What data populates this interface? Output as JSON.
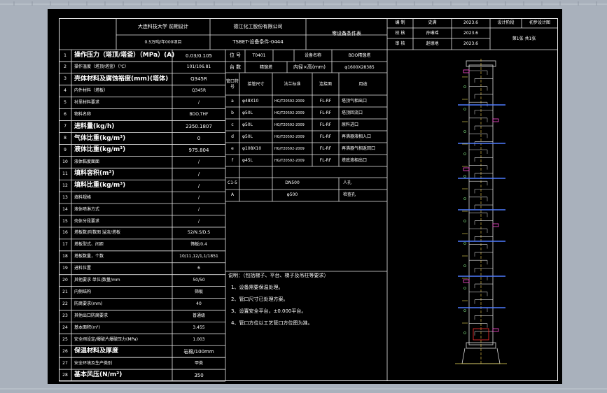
{
  "header": {
    "university": "大连科技大学 前期设计",
    "company": "德江化工股份有限公司",
    "doc_title": "零设备条件表",
    "scale": "0.5万吨/年000项目",
    "project_code": "TSBET-设备条件-0444",
    "sign_rows": [
      {
        "role": "编 制",
        "name": "史满",
        "date": "2023.6"
      },
      {
        "role": "校 核",
        "name": "孙琳瑶",
        "date": "2023.6"
      },
      {
        "role": "审 核",
        "name": "赵德地",
        "date": "2023.6"
      }
    ],
    "stage_label": "设计阶段",
    "stage_value": "初步设计图",
    "page_label": "第1张 共1张"
  },
  "spec_rows": [
    {
      "no": "1",
      "label": "操作压力（塔顶/塔釜）（MPa）(A)",
      "value": "0.03/0.105",
      "big": true
    },
    {
      "no": "2",
      "label": "操作温度（塔顶/塔釜）（℃）",
      "value": "101/106.81",
      "big": false
    },
    {
      "no": "3",
      "label": "壳体材料及腐蚀裕度(mm)(塔体)",
      "value": "Q345R",
      "big": true
    },
    {
      "no": "4",
      "label": "内件材料（塔板）",
      "value": "Q345R",
      "big": false
    },
    {
      "no": "5",
      "label": "衬里材料要求",
      "value": "/",
      "big": false
    },
    {
      "no": "6",
      "label": "物料名称",
      "value": "BDO,THF",
      "big": false
    },
    {
      "no": "7",
      "label": "进料量(kg/h)",
      "value": "2350.1807",
      "big": true
    },
    {
      "no": "8",
      "label": "气体比重(kg/m³)",
      "value": "0",
      "big": true
    },
    {
      "no": "9",
      "label": "液体比重(kg/m³)",
      "value": "975.804",
      "big": true
    },
    {
      "no": "10",
      "label": "液体黏度面面",
      "value": "/",
      "big": false
    },
    {
      "no": "11",
      "label": "填料容积(m³)",
      "value": "/",
      "big": true
    },
    {
      "no": "12",
      "label": "填料比重(kg/m³)",
      "value": "/",
      "big": true
    },
    {
      "no": "13",
      "label": "填料规格",
      "value": "/",
      "big": false
    },
    {
      "no": "14",
      "label": "液体喷淋方式",
      "value": "/",
      "big": false
    },
    {
      "no": "15",
      "label": "壳体分段要求",
      "value": "/",
      "big": false
    },
    {
      "no": "16",
      "label": "塔板数/阶数图 溢流/塔板",
      "value": "52/N.S/D.S",
      "big": false
    },
    {
      "no": "17",
      "label": "塔板型式、间距",
      "value": "筛板/0.4",
      "big": false
    },
    {
      "no": "18",
      "label": "塔板数量，个数",
      "value": "10/11,12/1,1/1851",
      "big": false
    },
    {
      "no": "19",
      "label": "进料位置",
      "value": "6",
      "big": false
    },
    {
      "no": "20",
      "label": "其他要求 单位/数量/mm",
      "value": "50/50",
      "big": false
    },
    {
      "no": "21",
      "label": "内侧结构",
      "value": "筛板",
      "big": false
    },
    {
      "no": "22",
      "label": "防腐要求(mm)",
      "value": "40",
      "big": false
    },
    {
      "no": "23",
      "label": "其他出口防腐要求",
      "value": "普通级",
      "big": false
    },
    {
      "no": "24",
      "label": "基本面积(m²)",
      "value": "3.455",
      "big": false
    },
    {
      "no": "25",
      "label": "安全阀设定/爆破片爆破压力(MPa)",
      "value": "1.003",
      "big": false
    },
    {
      "no": "26",
      "label": "保温材料及厚度",
      "value": "岩棉/100mm",
      "big": true
    },
    {
      "no": "27",
      "label": "安全环境及生产类别",
      "value": "甲类",
      "big": false
    },
    {
      "no": "28",
      "label": "基本风压(N/m²)",
      "value": "350",
      "big": true
    }
  ],
  "info": {
    "position_label": "位 号",
    "position_value": "T0401",
    "name_label": "设备名称",
    "name_value": "BDO精馏塔",
    "count_label": "台 数",
    "count_value": "精馏塔",
    "diameter_label": "内径×高(mm)",
    "diameter_value": "φ1600X28385"
  },
  "nozzle_header": {
    "mark": "管口符号",
    "size": "接管尺寸",
    "std": "法兰标准",
    "face": "连接面",
    "use": "用途"
  },
  "nozzles": [
    {
      "mark": "a",
      "size": "φ48X10",
      "std": "HG/T20592-2009",
      "face": "FL-RF",
      "use": "塔顶气相出口"
    },
    {
      "mark": "b",
      "size": "φ50L",
      "std": "HG/T20592-2009",
      "face": "FL-RF",
      "use": "塔顶回流口"
    },
    {
      "mark": "c",
      "size": "φ50L",
      "std": "HG/T20592-2009",
      "face": "FL-RF",
      "use": "原料进口"
    },
    {
      "mark": "d",
      "size": "φ50L",
      "std": "HG/T20592-2009",
      "face": "FL-RF",
      "use": "再沸器液相入口"
    },
    {
      "mark": "e",
      "size": "φ108X10",
      "std": "HG/T20592-2009",
      "face": "FL-RF",
      "use": "再沸器气相返回口"
    },
    {
      "mark": "f",
      "size": "φ45L",
      "std": "HG/T20592-2009",
      "face": "FL-RF",
      "use": "塔底液相出口"
    }
  ],
  "manhole": [
    {
      "mark": "C1-5",
      "size": "DN500",
      "use": "人孔"
    },
    {
      "mark": "A",
      "size": "φ500",
      "use": "检查孔"
    }
  ],
  "notes": {
    "title": "说明：（包括梯子、平台、梯子及吊柱等要求）",
    "items": [
      "1、设备需要保温处理。",
      "2、管口尺寸已处理方案。",
      "3、设置安全平台，±0.000平台。",
      "4、管口方位以工艺管口方位图为准。"
    ]
  },
  "drawing": {
    "label": "tower-elevation"
  }
}
